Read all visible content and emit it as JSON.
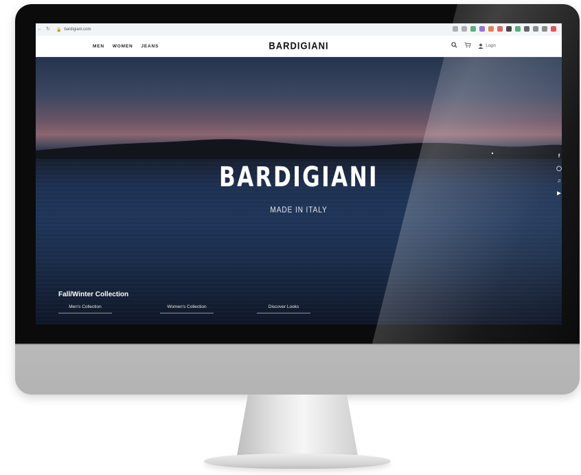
{
  "browser": {
    "url": "bardigiani.com",
    "back_icon": "back-arrow-icon",
    "reload_icon": "reload-icon",
    "extension_colors": [
      "#9aa0a6",
      "#9aa0a6",
      "#2e9e5b",
      "#7b4fd6",
      "#e05a2a",
      "#d93a3a",
      "#1a1a1a",
      "#2e9e5b",
      "#444444",
      "#777777",
      "#777777",
      "#d93a3a"
    ]
  },
  "header": {
    "nav": [
      "MEN",
      "WOMEN",
      "JEANS"
    ],
    "brand": "BARDIGIANI",
    "search_icon": "search-icon",
    "cart_icon": "cart-icon",
    "login_label": "Login"
  },
  "hero": {
    "title": "BARDIGIANI",
    "subtitle": "MADE IN ITALY",
    "social": [
      "facebook-icon",
      "instagram-icon",
      "tiktok-icon",
      "youtube-icon"
    ]
  },
  "collection": {
    "title": "Fall/Winter Collection",
    "links": [
      "Men's Collection",
      "Women's Collection",
      "Discover Looks"
    ]
  }
}
